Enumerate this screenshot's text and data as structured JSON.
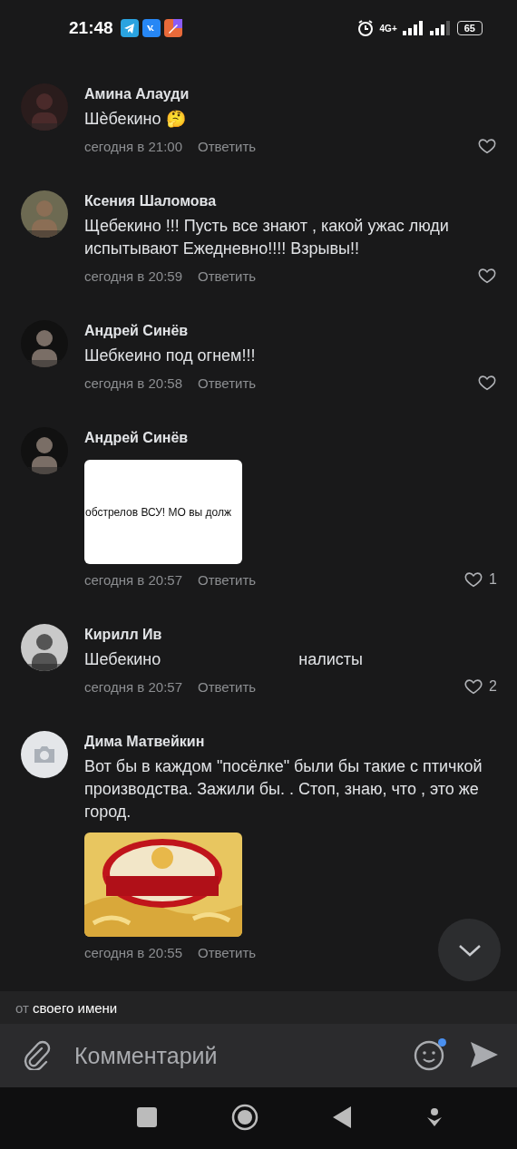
{
  "status_bar": {
    "time": "21:48",
    "network": "4G+",
    "battery": "65"
  },
  "comments": [
    {
      "author": "Амина Алауди",
      "text_parts": [
        "Шѐбекино 🤔"
      ],
      "avatar": {
        "kind": "picture"
      },
      "time": "сегодня в 21:00",
      "reply": "Ответить",
      "like_button": true
    },
    {
      "author": "Ксения Шаломова",
      "text_parts": [
        "Щебекино !!! Пусть все знают , какой ужас люди испытывают Ежедневно!!!! Взрывы!!"
      ],
      "avatar": {
        "kind": "picture"
      },
      "time": "сегодня в 20:59",
      "reply": "Ответить",
      "like_button": true
    },
    {
      "author": "Андрей Синёв",
      "text_parts": [
        "Шебкеино под огнем!!!"
      ],
      "avatar": {
        "kind": "picture"
      },
      "time": "сегодня в 20:58",
      "reply": "Ответить",
      "like_button": true
    },
    {
      "author": "Андрей Синёв",
      "avatar": {
        "kind": "picture"
      },
      "attachment": {
        "kind": "document",
        "text": "обстрелов ВСУ! МО вы долж"
      },
      "time": "сегодня в 20:57",
      "reply": "Ответить",
      "like_button": true,
      "likes": "1"
    },
    {
      "author": "Кирилл Ив",
      "text_parts": [
        "Шебекино",
        "налисты"
      ],
      "avatar": {
        "kind": "picture"
      },
      "time": "сегодня в 20:57",
      "reply": "Ответить",
      "like_button": true,
      "likes": "2"
    },
    {
      "author": "Дима Матвейкин",
      "text_parts": [
        "Вот бы в каждом \"посёлке\" были бы такие с птичкой производства. Зажили бы. . Стоп, знаю, что , это же город."
      ],
      "avatar": {
        "kind": "placeholder"
      },
      "attachment": {
        "kind": "picture"
      },
      "time": "сегодня в 20:55",
      "reply": "Ответить",
      "like_button": false
    }
  ],
  "composer": {
    "from_label": "от",
    "from_name": "своего имени",
    "placeholder": "Комментарий",
    "emoji_badge": true
  }
}
